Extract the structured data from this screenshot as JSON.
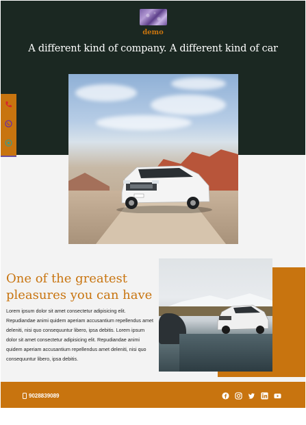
{
  "brand": {
    "name": "demo"
  },
  "header": {
    "headline": "A different kind of company. A different kind of car"
  },
  "side_contact": {
    "icons": [
      "phone-icon",
      "whatsapp-icon",
      "location-icon"
    ]
  },
  "feature": {
    "heading": "One of the greatest pleasures you can have",
    "paragraph": "Lorem ipsum dolor sit amet consectetur adipisicing elit. Repudiandae animi quidem aperiam accusantium repellendus amet deleniti, nisi quo consequuntur libero, ipsa debitis. Lorem ipsum dolor sit amet consectetur adipisicing elit. Repudiandae animi quidem aperiam accusantium repellendus amet deleniti, nisi quo consequuntur libero, ipsa debitis."
  },
  "footer": {
    "phone": "9028839089",
    "socials": [
      "facebook-icon",
      "instagram-icon",
      "twitter-icon",
      "linkedin-icon",
      "youtube-icon"
    ]
  },
  "colors": {
    "accent": "#c8740f",
    "dark": "#1b2822",
    "light": "#f3f3f3"
  }
}
